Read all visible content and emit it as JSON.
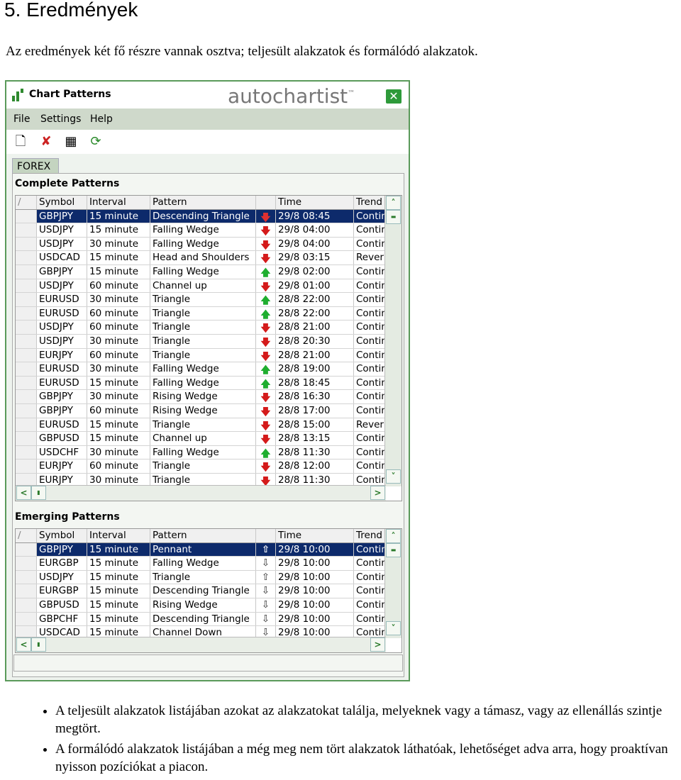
{
  "heading": "5. Eredmények",
  "intro": "Az eredmények két fő részre vannak osztva; teljesült alakzatok és formálódó alakzatok.",
  "window": {
    "title": "Chart Patterns",
    "brand": "autochartist",
    "brand_tm": "™",
    "menu": [
      "File",
      "Settings",
      "Help"
    ],
    "toolbar": [
      {
        "icon": "new-document-icon",
        "glyph": "🗋"
      },
      {
        "icon": "delete-icon",
        "glyph": "✘"
      },
      {
        "icon": "table-icon",
        "glyph": "▦"
      },
      {
        "icon": "refresh-icon",
        "glyph": "⟳"
      }
    ],
    "tab": "FOREX",
    "columns": [
      "/",
      "Symbol",
      "Interval",
      "Pattern",
      "",
      "Time",
      "Trend"
    ],
    "complete": {
      "title": "Complete Patterns",
      "rows": [
        [
          "GBPJPY",
          "15 minute",
          "Descending Triangle",
          "down",
          "29/8 08:45",
          "Contin",
          true
        ],
        [
          "USDJPY",
          "15 minute",
          "Falling Wedge",
          "down",
          "29/8 04:00",
          "Contin"
        ],
        [
          "USDJPY",
          "30 minute",
          "Falling Wedge",
          "down",
          "29/8 04:00",
          "Contin"
        ],
        [
          "USDCAD",
          "15 minute",
          "Head and Shoulders",
          "down",
          "29/8 03:15",
          "Rever"
        ],
        [
          "GBPJPY",
          "15 minute",
          "Falling Wedge",
          "up",
          "29/8 02:00",
          "Contin"
        ],
        [
          "USDJPY",
          "60 minute",
          "Channel up",
          "down",
          "29/8 01:00",
          "Contin"
        ],
        [
          "EURUSD",
          "30 minute",
          "Triangle",
          "up",
          "28/8 22:00",
          "Contin"
        ],
        [
          "EURUSD",
          "60 minute",
          "Triangle",
          "up",
          "28/8 22:00",
          "Contin"
        ],
        [
          "USDJPY",
          "60 minute",
          "Triangle",
          "down",
          "28/8 21:00",
          "Contin"
        ],
        [
          "USDJPY",
          "30 minute",
          "Triangle",
          "down",
          "28/8 20:30",
          "Contin"
        ],
        [
          "EURJPY",
          "60 minute",
          "Triangle",
          "down",
          "28/8 21:00",
          "Contin"
        ],
        [
          "EURUSD",
          "30 minute",
          "Falling Wedge",
          "up",
          "28/8 19:00",
          "Contin"
        ],
        [
          "EURUSD",
          "15 minute",
          "Falling Wedge",
          "up",
          "28/8 18:45",
          "Contin"
        ],
        [
          "GBPJPY",
          "30 minute",
          "Rising Wedge",
          "down",
          "28/8 16:30",
          "Contin"
        ],
        [
          "GBPJPY",
          "60 minute",
          "Rising Wedge",
          "down",
          "28/8 17:00",
          "Contin"
        ],
        [
          "EURUSD",
          "15 minute",
          "Triangle",
          "down",
          "28/8 15:00",
          "Rever"
        ],
        [
          "GBPUSD",
          "15 minute",
          "Channel up",
          "down",
          "28/8 13:15",
          "Contin"
        ],
        [
          "USDCHF",
          "30 minute",
          "Falling Wedge",
          "up",
          "28/8 11:30",
          "Contin"
        ],
        [
          "EURJPY",
          "60 minute",
          "Triangle",
          "down",
          "28/8 12:00",
          "Contin"
        ],
        [
          "EURJPY",
          "30 minute",
          "Triangle",
          "down",
          "28/8 11:30",
          "Contin"
        ]
      ]
    },
    "emerging": {
      "title": "Emerging Patterns",
      "rows": [
        [
          "GBPJPY",
          "15 minute",
          "Pennant",
          "up-outline",
          "29/8 10:00",
          "Contin",
          true
        ],
        [
          "EURGBP",
          "15 minute",
          "Falling Wedge",
          "down-outline",
          "29/8 10:00",
          "Contin"
        ],
        [
          "USDJPY",
          "15 minute",
          "Triangle",
          "up-outline",
          "29/8 10:00",
          "Contin"
        ],
        [
          "EURGBP",
          "15 minute",
          "Descending Triangle",
          "down-outline",
          "29/8 10:00",
          "Contin"
        ],
        [
          "GBPUSD",
          "15 minute",
          "Rising Wedge",
          "down-outline",
          "29/8 10:00",
          "Contin"
        ],
        [
          "GBPCHF",
          "15 minute",
          "Descending Triangle",
          "down-outline",
          "29/8 10:00",
          "Contin"
        ],
        [
          "USDCAD",
          "15 minute",
          "Channel Down",
          "down-outline",
          "29/8 10:00",
          "Contin"
        ]
      ]
    },
    "colors": {
      "up": "#1fae2f",
      "down": "#d41a1a",
      "selected": "#0d2a6b"
    }
  },
  "bullets": [
    "A teljesült alakzatok listájában azokat az alakzatokat találja, melyeknek vagy a támasz, vagy az ellenállás szintje megtört.",
    "A formálódó alakzatok listájában a még meg nem tört alakzatok láthatóak, lehetőséget adva arra, hogy proaktívan nyisson pozíciókat a piacon."
  ]
}
